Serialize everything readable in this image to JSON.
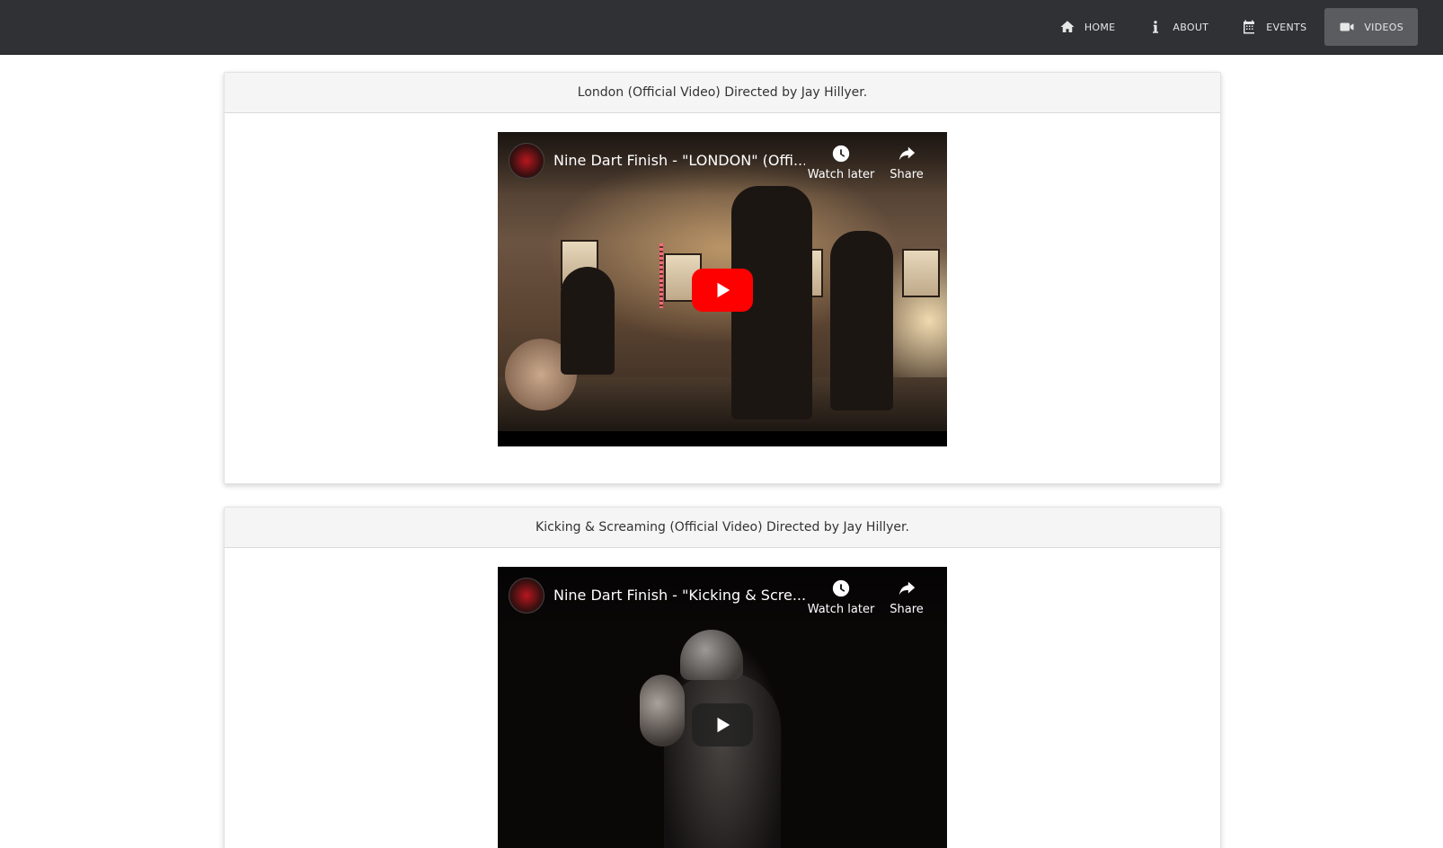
{
  "nav": {
    "items": [
      {
        "label": "HOME",
        "icon": "home-icon"
      },
      {
        "label": "ABOUT",
        "icon": "info-icon"
      },
      {
        "label": "EVENTS",
        "icon": "calendar-icon"
      },
      {
        "label": "VIDEOS",
        "icon": "video-camera-icon",
        "active": true
      }
    ]
  },
  "videos": [
    {
      "header": "London (Official Video) Directed by Jay Hillyer.",
      "title": "Nine Dart Finish - \"LONDON\" (Offi...",
      "watch_later": "Watch later",
      "share": "Share"
    },
    {
      "header": "Kicking & Screaming (Official Video) Directed by Jay Hillyer.",
      "title": "Nine Dart Finish - \"Kicking & Scre...",
      "watch_later": "Watch later",
      "share": "Share"
    }
  ],
  "colors": {
    "navbar_bg": "#2f3135",
    "active_nav_bg": "#5a5c60",
    "play_red": "#ff0000"
  }
}
